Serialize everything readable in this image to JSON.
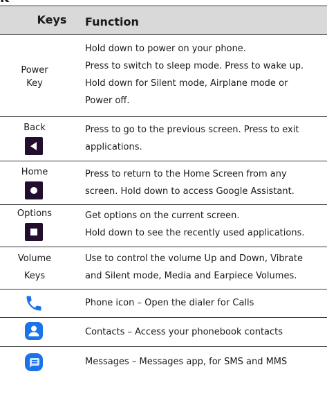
{
  "table": {
    "header": {
      "keys": "Keys",
      "function": "Function"
    },
    "rows": [
      {
        "key_lines": [
          "Power",
          "Key"
        ],
        "function_lines": [
          "Hold down to power on your phone.",
          "Press to switch to sleep mode. Press to wake up.",
          "Hold down for Silent mode, Airplane mode or",
          "Power off."
        ]
      },
      {
        "key": "Back",
        "icon": "back-triangle-icon",
        "function_lines": [
          "Press to go to the previous screen. Press to exit",
          "applications."
        ]
      },
      {
        "key": "Home",
        "icon": "home-circle-icon",
        "function_lines": [
          "Press to return to the Home Screen from any",
          "screen. Hold down to access Google Assistant."
        ]
      },
      {
        "key": "Options",
        "icon": "options-square-icon",
        "function_lines": [
          "Get options on the current screen.",
          "Hold down to see the recently used applications."
        ]
      },
      {
        "key_lines": [
          "Volume",
          "Keys"
        ],
        "function_lines": [
          "Use to control the volume Up and Down, Vibrate",
          "and Silent mode, Media and Earpiece Volumes."
        ]
      },
      {
        "icon": "phone-icon",
        "function_lines": [
          "Phone icon – Open the dialer for Calls"
        ]
      },
      {
        "icon": "contacts-icon",
        "function_lines": [
          "Contacts – Access your phonebook contacts"
        ]
      },
      {
        "icon": "messages-icon",
        "function_lines": [
          "Messages – Messages app, for SMS and MMS"
        ]
      }
    ]
  },
  "colors": {
    "header_bg": "#d9d9d9",
    "nav_icon_bg": "#230f2d",
    "app_icon_blue": "#1a73e8"
  }
}
